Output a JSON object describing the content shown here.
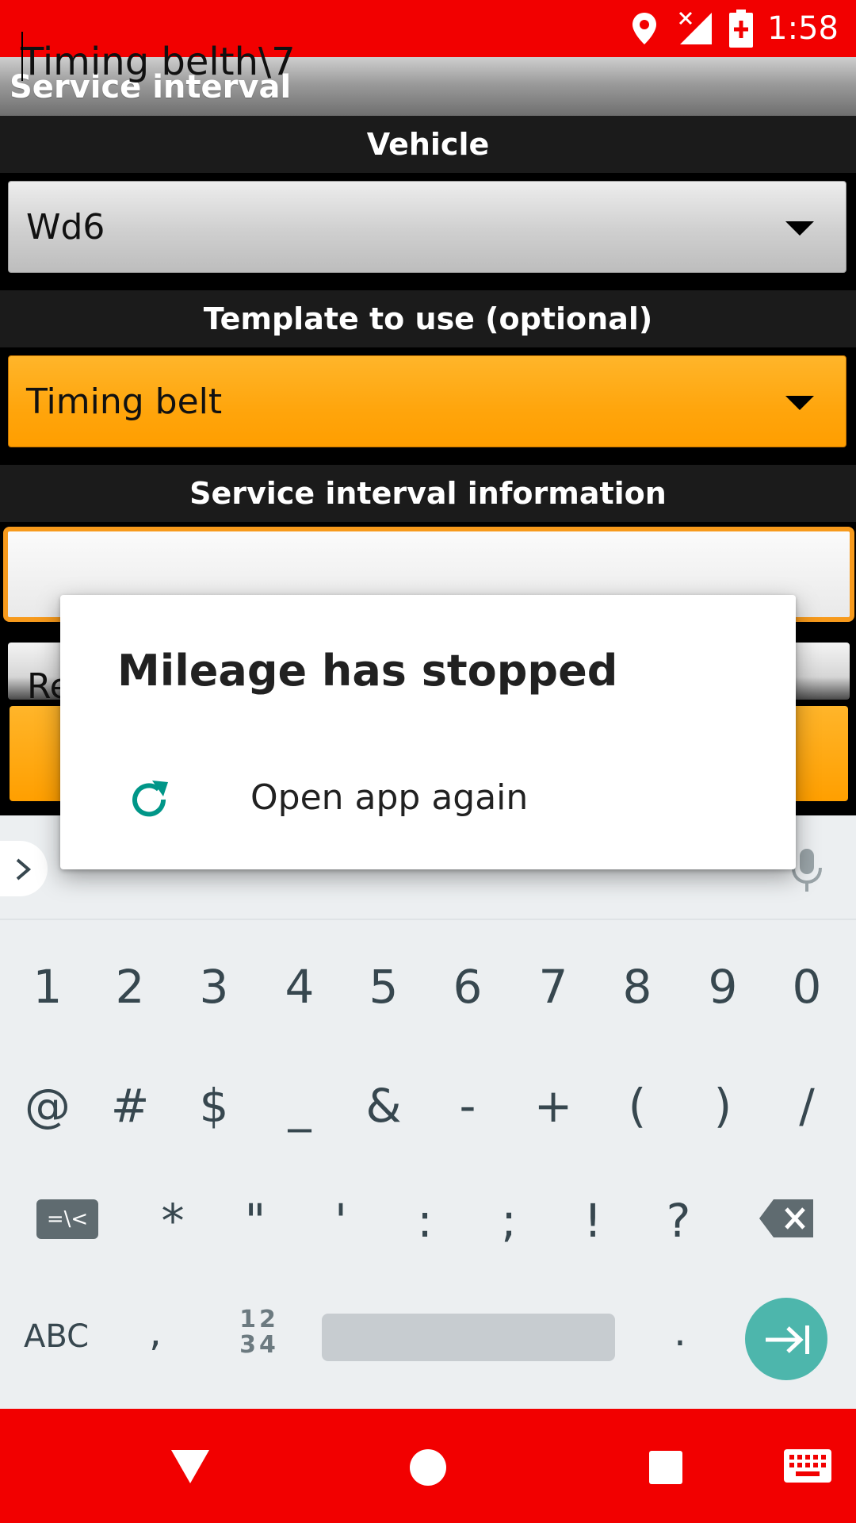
{
  "status_bar": {
    "time": "1:58",
    "icons": [
      "location-icon",
      "signal-no-service-icon",
      "battery-charging-icon"
    ]
  },
  "toolbar": {
    "title": "Service interval"
  },
  "sections": {
    "vehicle": "Vehicle",
    "template": "Template to use (optional)",
    "info": "Service interval information"
  },
  "vehicle_spinner": {
    "value": "Wd6"
  },
  "template_spinner": {
    "value": "Timing belt"
  },
  "name_field": {
    "value": "Timing belth\\7"
  },
  "second_field": {
    "value": "Re"
  },
  "dialog": {
    "title": "Mileage has stopped",
    "reopen_label": "Open app again"
  },
  "keyboard": {
    "row1": [
      "1",
      "2",
      "3",
      "4",
      "5",
      "6",
      "7",
      "8",
      "9",
      "0"
    ],
    "row2": [
      "@",
      "#",
      "$",
      "_",
      "&",
      "-",
      "+",
      "(",
      ")",
      "/"
    ],
    "row3": [
      "*",
      "\"",
      "'",
      ":",
      ";",
      "!",
      "?"
    ],
    "symbols_label": "=\\<",
    "abc_label": "ABC",
    "comma": ",",
    "numpad_label_top": "12",
    "numpad_label_bottom": "34",
    "period": "."
  },
  "colors": {
    "status": "#f20000",
    "accent": "#ffa500",
    "dialog_icon": "#009688",
    "enter": "#4db6ac"
  }
}
